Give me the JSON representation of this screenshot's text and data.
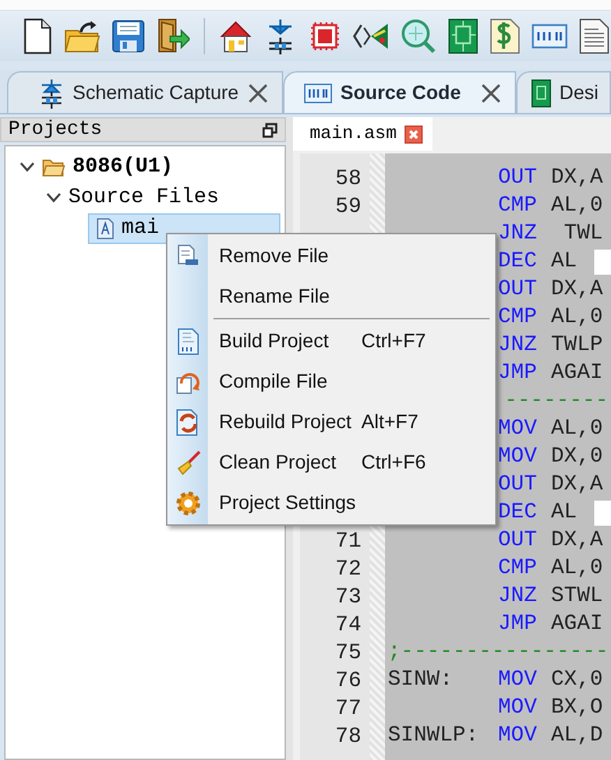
{
  "tabs": [
    {
      "label": "Schematic Capture",
      "kind": "schematic",
      "selected": false,
      "closable": true
    },
    {
      "label": "Source Code",
      "kind": "source",
      "selected": true,
      "closable": true
    },
    {
      "label": "Desi",
      "kind": "design",
      "selected": false,
      "closable": false
    }
  ],
  "projects_panel": {
    "title": "Projects",
    "tree": [
      {
        "label": "8086(U1)",
        "kind": "project",
        "expanded": true,
        "selected": false,
        "children": [
          {
            "label": "Source Files",
            "expanded": true,
            "selected": false,
            "children": [
              {
                "label": "mai",
                "kind": "file",
                "selected": true
              }
            ]
          }
        ]
      }
    ]
  },
  "editor": {
    "file_tab": "main.asm",
    "lines": [
      {
        "number": "58",
        "kind": "code",
        "mnemonic": "OUT",
        "operand": "DX,A",
        "marked": false
      },
      {
        "number": "59",
        "kind": "code",
        "mnemonic": "CMP",
        "operand": "AL,0",
        "marked": false
      },
      {
        "kind": "code",
        "mnemonic": "JNZ",
        "operand": " TWL",
        "marked": false
      },
      {
        "kind": "code",
        "mnemonic": "DEC",
        "operand": "AL",
        "marked": true
      },
      {
        "kind": "code",
        "mnemonic": "OUT",
        "operand": "DX,A",
        "marked": false
      },
      {
        "kind": "code",
        "mnemonic": "CMP",
        "operand": "AL,0",
        "marked": false
      },
      {
        "kind": "code",
        "mnemonic": "JNZ",
        "operand": "TWLP",
        "marked": false
      },
      {
        "kind": "code",
        "mnemonic": "JMP",
        "operand": "AGAI",
        "marked": false
      },
      {
        "kind": "comment_tail",
        "comment": "--------"
      },
      {
        "kind": "code",
        "mnemonic": "MOV",
        "operand": "AL,0",
        "marked": false
      },
      {
        "kind": "code",
        "mnemonic": "MOV",
        "operand": "DX,0",
        "marked": false
      },
      {
        "kind": "code",
        "mnemonic": "OUT",
        "operand": "DX,A",
        "marked": false
      },
      {
        "kind": "code",
        "mnemonic": "DEC",
        "operand": "AL",
        "marked": true
      },
      {
        "number": "71",
        "kind": "code",
        "mnemonic": "OUT",
        "operand": "DX,A",
        "marked": false
      },
      {
        "number": "72",
        "kind": "code",
        "mnemonic": "CMP",
        "operand": "AL,0",
        "marked": false
      },
      {
        "number": "73",
        "kind": "code",
        "mnemonic": "JNZ",
        "operand": "STWL",
        "marked": false
      },
      {
        "number": "74",
        "kind": "code",
        "mnemonic": "JMP",
        "operand": "AGAI",
        "marked": false
      },
      {
        "number": "75",
        "kind": "comment",
        "comment": ";----------------"
      },
      {
        "number": "76",
        "kind": "code",
        "label": "SINW:",
        "mnemonic": "MOV",
        "operand": "CX,0",
        "marked": false
      },
      {
        "number": "77",
        "kind": "code",
        "mnemonic": "MOV",
        "operand": "BX,O",
        "marked": false
      },
      {
        "number": "78",
        "kind": "code",
        "label": "SINWLP:",
        "mnemonic": "MOV",
        "operand": "AL,D",
        "marked": false
      }
    ]
  },
  "context_menu": [
    {
      "kind": "item",
      "label": "Remove File"
    },
    {
      "kind": "item",
      "label": "Rename File"
    },
    {
      "kind": "separator"
    },
    {
      "kind": "item",
      "label": "Build Project",
      "shortcut": "Ctrl+F7"
    },
    {
      "kind": "item",
      "label": "Compile File"
    },
    {
      "kind": "item",
      "label": "Rebuild Project",
      "shortcut": "Alt+F7"
    },
    {
      "kind": "item",
      "label": "Clean Project",
      "shortcut": "Ctrl+F6"
    },
    {
      "kind": "item",
      "label": "Project Settings"
    }
  ]
}
